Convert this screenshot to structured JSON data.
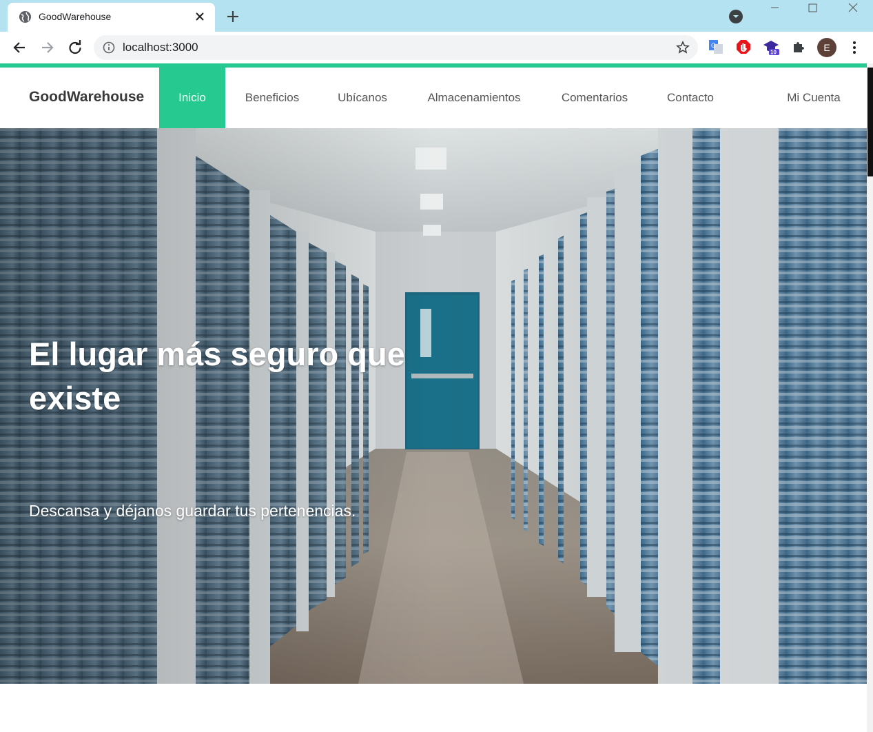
{
  "browser": {
    "tab_title": "GoodWarehouse",
    "address": "localhost:3000",
    "profile_initial": "E",
    "extension_badge": "10"
  },
  "site": {
    "brand": "GoodWarehouse",
    "accent_color": "#26c98f",
    "nav": [
      {
        "label": "Inicio",
        "active": true
      },
      {
        "label": "Beneficios"
      },
      {
        "label": "Ubícanos"
      },
      {
        "label": "Almacenamientos"
      },
      {
        "label": "Comentarios"
      },
      {
        "label": "Contacto"
      },
      {
        "label": "Mi Cuenta"
      }
    ]
  },
  "hero": {
    "title": "El lugar más seguro que existe",
    "subtitle": "Descansa y déjanos guardar tus pertenencias."
  }
}
